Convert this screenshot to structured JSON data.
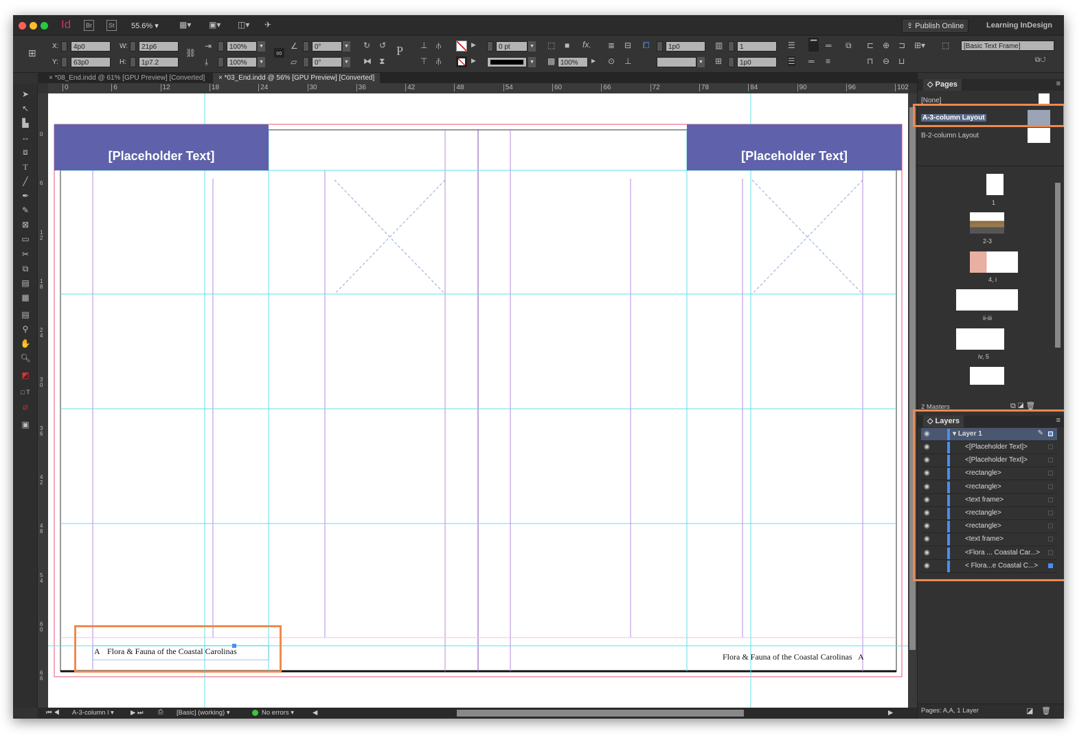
{
  "app": {
    "logo": "Id",
    "bridge": "Br",
    "stock": "St",
    "zoom": "55.6%",
    "publish_label": "Publish Online",
    "workspace": "Learning InDesign"
  },
  "control": {
    "x_label": "X:",
    "x": "4p0",
    "y_label": "Y:",
    "y": "63p0",
    "w_label": "W:",
    "w": "21p6",
    "h_label": "H:",
    "h": "1p7.2",
    "scale_x": "100%",
    "scale_y": "100%",
    "rotate": "0°",
    "shear": "0°",
    "stroke_weight": "0 pt",
    "opacity": "100%",
    "inset": "1p0",
    "columns": "1",
    "gutter": "1p0",
    "object_style": "[Basic Text Frame]"
  },
  "tabs": [
    {
      "label": "*08_End.indd @ 61% [GPU Preview] [Converted]",
      "active": false
    },
    {
      "label": "*03_End.indd @ 56% [GPU Preview] [Converted]",
      "active": true
    }
  ],
  "ruler": [
    "0",
    "6",
    "12",
    "18",
    "24",
    "30",
    "36",
    "42",
    "48",
    "54",
    "60",
    "66",
    "72",
    "78",
    "84",
    "90",
    "96",
    "102"
  ],
  "vruler": [
    "0",
    "6",
    "12",
    "18",
    "24",
    "30",
    "36",
    "42",
    "48",
    "54",
    "60",
    "66"
  ],
  "document": {
    "placeholder_left": "[Placeholder Text]",
    "placeholder_right": "[Placeholder Text]",
    "footer_left_marker": "A",
    "footer_left": "Flora & Fauna of the Coastal Carolinas",
    "footer_right": "Flora & Fauna of the Coastal Carolinas",
    "footer_right_marker": "A",
    "placeholder_color": "#5f62aa"
  },
  "pages_panel": {
    "title": "Pages",
    "masters": [
      {
        "label": "[None]",
        "selected": false
      },
      {
        "label": "A-3-column Layout",
        "selected": true
      },
      {
        "label": "B-2-column Layout",
        "selected": false
      }
    ],
    "spreads": [
      "1",
      "2-3",
      "4, i",
      "ii-iii",
      "iv, 5"
    ],
    "footer": "2 Masters"
  },
  "layers_panel": {
    "title": "Layers",
    "layer": "Layer 1",
    "items": [
      "<[Placeholder Text]>",
      "<[Placeholder Text]>",
      "<rectangle>",
      "<rectangle>",
      "<text frame>",
      "<rectangle>",
      "<rectangle>",
      "<text frame>",
      "<Flora ... Coastal Car...>",
      "<   Flora...e Coastal C...>"
    ],
    "footer": "Pages: A,A, 1 Layer"
  },
  "status": {
    "page": "A-3-column l",
    "preflight_profile": "[Basic] (working)",
    "errors": "No errors"
  },
  "highlight_color": "#ee8a4f"
}
